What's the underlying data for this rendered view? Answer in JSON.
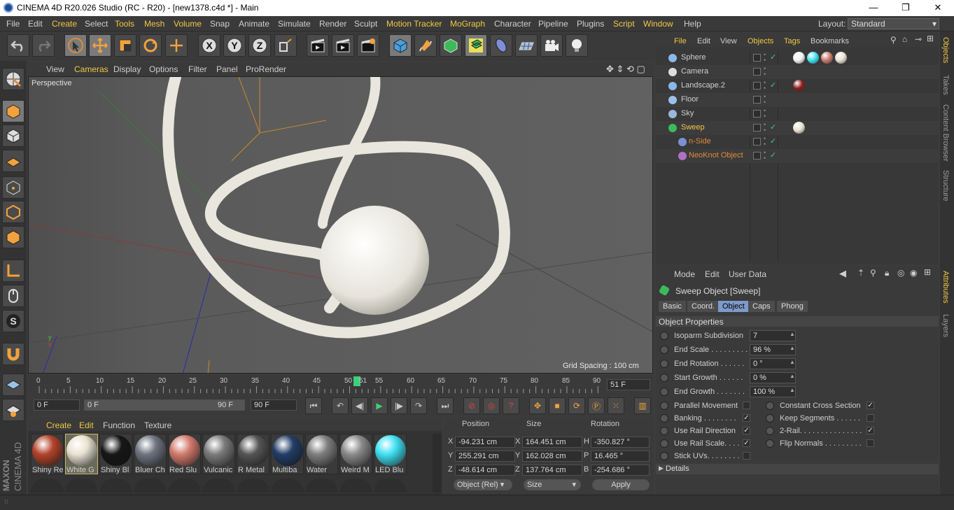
{
  "titlebar": {
    "title": "CINEMA 4D R20.026 Studio (RC - R20) - [new1378.c4d *] - Main",
    "min": "—",
    "max": "❐",
    "close": "✕"
  },
  "menubar": {
    "items": [
      "File",
      "Edit",
      "Create",
      "Select",
      "Tools",
      "Mesh",
      "Volume",
      "Snap",
      "Animate",
      "Simulate",
      "Render",
      "Sculpt",
      "Motion Tracker",
      "MoGraph",
      "Character",
      "Pipeline",
      "Plugins",
      "Script",
      "Window",
      "Help"
    ],
    "layout_label": "Layout:",
    "layout_value": "Standard"
  },
  "viewport": {
    "menu": [
      "View",
      "Cameras",
      "Display",
      "Options",
      "Filter",
      "Panel",
      "ProRender"
    ],
    "label": "Perspective",
    "grid_spacing": "Grid Spacing : 100 cm"
  },
  "timeline": {
    "ticks": [
      "0",
      "5",
      "10",
      "15",
      "20",
      "25",
      "30",
      "35",
      "40",
      "45",
      "50",
      "51",
      "55",
      "60",
      "65",
      "70",
      "75",
      "80",
      "85",
      "90"
    ],
    "current_frame": "51 F",
    "start": "0 F",
    "range_start": "0 F",
    "range_end": "90 F",
    "end": "90 F"
  },
  "materials": {
    "menu": [
      "Create",
      "Edit",
      "Function",
      "Texture"
    ],
    "items": [
      {
        "name": "Shiny Re",
        "color": "#b3432b"
      },
      {
        "name": "White G",
        "color": "#e8e2d2"
      },
      {
        "name": "Shiny Bl",
        "color": "#161616"
      },
      {
        "name": "Bluer Ch",
        "color": "#6d7480"
      },
      {
        "name": "Red Slu",
        "color": "#d27a6c"
      },
      {
        "name": "Vulcanic",
        "color": "#7b7b7b"
      },
      {
        "name": "R Metal",
        "color": "#555555"
      },
      {
        "name": "Multiba",
        "color": "#223d66"
      },
      {
        "name": "Water",
        "color": "#7e7e7e"
      },
      {
        "name": "Weird M",
        "color": "#8a8a8a"
      },
      {
        "name": "LED Blu",
        "color": "#3fe0f2"
      }
    ]
  },
  "coords": {
    "headers": [
      "Position",
      "Size",
      "Rotation"
    ],
    "rows": [
      {
        "axis": "X",
        "pos": "-94.231 cm",
        "size_axis": "X",
        "size": "164.451 cm",
        "rot_axis": "H",
        "rot": "-350.827 °"
      },
      {
        "axis": "Y",
        "pos": "255.291 cm",
        "size_axis": "Y",
        "size": "162.028 cm",
        "rot_axis": "P",
        "rot": "16.465 °"
      },
      {
        "axis": "Z",
        "pos": "-48.614 cm",
        "size_axis": "Z",
        "size": "137.764 cm",
        "rot_axis": "B",
        "rot": "-254.686 °"
      }
    ],
    "mode": "Object (Rel)",
    "size_mode": "Size",
    "apply": "Apply"
  },
  "objects": {
    "menu": [
      "File",
      "Edit",
      "View",
      "Objects",
      "Tags",
      "Bookmarks"
    ],
    "items": [
      {
        "name": "Sphere",
        "indent": 0,
        "color": "#cfcfcf"
      },
      {
        "name": "Camera",
        "indent": 0,
        "color": "#cfcfcf"
      },
      {
        "name": "Landscape.2",
        "indent": 0,
        "color": "#cfcfcf"
      },
      {
        "name": "Floor",
        "indent": 0,
        "color": "#cfcfcf"
      },
      {
        "name": "Sky",
        "indent": 0,
        "color": "#cfcfcf"
      },
      {
        "name": "Sweep",
        "indent": 0,
        "color": "#f2c744"
      },
      {
        "name": "n-Side",
        "indent": 1,
        "color": "#e08a3c"
      },
      {
        "name": "NeoKnot Object",
        "indent": 1,
        "color": "#e08a3c"
      }
    ]
  },
  "attributes": {
    "menu": [
      "Mode",
      "Edit",
      "User Data"
    ],
    "title": "Sweep Object [Sweep]",
    "tabs": [
      "Basic",
      "Coord.",
      "Object",
      "Caps",
      "Phong"
    ],
    "section": "Object Properties",
    "fields": [
      {
        "label": "Isoparm Subdivision",
        "value": "7"
      },
      {
        "label": "End Scale . . . . . . . . . .",
        "value": "96 %"
      },
      {
        "label": "End Rotation . . . . . .",
        "value": "0 °"
      },
      {
        "label": "Start Growth . . . . . .",
        "value": "0 %"
      },
      {
        "label": "End Growth . . . . . . .",
        "value": "100 %"
      }
    ],
    "checks_left": [
      {
        "label": "Parallel Movement",
        "checked": ""
      },
      {
        "label": "Banking . . . . . . . .",
        "checked": "✓"
      },
      {
        "label": "Use Rail Direction",
        "checked": "✓"
      },
      {
        "label": "Use Rail Scale. . . .",
        "checked": "✓"
      },
      {
        "label": "Stick UVs. . . . . . . .",
        "checked": ""
      }
    ],
    "checks_right": [
      {
        "label": "Constant Cross Section",
        "checked": "✓"
      },
      {
        "label": "Keep Segments . . . . . .",
        "checked": ""
      },
      {
        "label": "2-Rail. . . . . . . . . . . . . . .",
        "checked": "✓"
      },
      {
        "label": "Flip Normals . . . . . . . . .",
        "checked": ""
      }
    ],
    "details": "Details"
  },
  "sidetabs": [
    "Objects",
    "Takes",
    "Content Browser",
    "Structure",
    "Attributes",
    "Layers"
  ],
  "branding": {
    "maxon": "MAXON",
    "cinema": "CINEMA 4D"
  }
}
